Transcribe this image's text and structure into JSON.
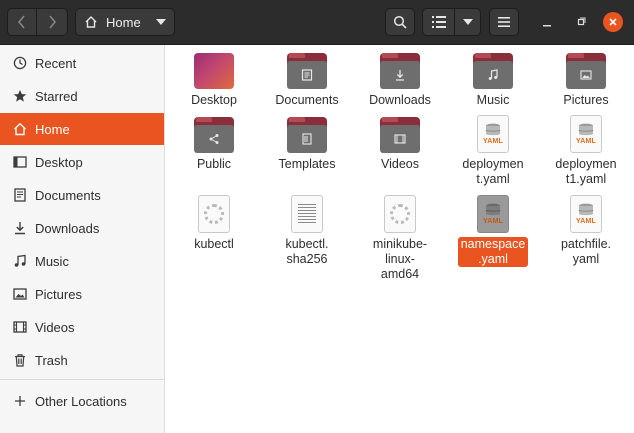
{
  "header": {
    "path_label": "Home",
    "accent_color": "#e95420"
  },
  "sidebar": {
    "items": [
      {
        "label": "Recent",
        "icon": "clock-icon"
      },
      {
        "label": "Starred",
        "icon": "star-icon"
      },
      {
        "label": "Home",
        "icon": "home-icon",
        "active": true
      },
      {
        "label": "Desktop",
        "icon": "desktop-icon"
      },
      {
        "label": "Documents",
        "icon": "document-icon"
      },
      {
        "label": "Downloads",
        "icon": "download-icon"
      },
      {
        "label": "Music",
        "icon": "music-icon"
      },
      {
        "label": "Pictures",
        "icon": "picture-icon"
      },
      {
        "label": "Videos",
        "icon": "video-icon"
      },
      {
        "label": "Trash",
        "icon": "trash-icon"
      },
      {
        "label": "Other Locations",
        "icon": "plus-icon"
      }
    ]
  },
  "files": [
    {
      "name": "Desktop",
      "type": "desktop-folder"
    },
    {
      "name": "Documents",
      "type": "folder",
      "icon": "document-icon"
    },
    {
      "name": "Downloads",
      "type": "folder",
      "icon": "download-icon"
    },
    {
      "name": "Music",
      "type": "folder",
      "icon": "music-icon"
    },
    {
      "name": "Pictures",
      "type": "folder",
      "icon": "picture-icon"
    },
    {
      "name": "Public",
      "type": "folder",
      "icon": "share-icon"
    },
    {
      "name": "Templates",
      "type": "folder",
      "icon": "template-icon"
    },
    {
      "name": "Videos",
      "type": "folder",
      "icon": "video-icon"
    },
    {
      "name": "deploymen\nt.yaml",
      "type": "yaml"
    },
    {
      "name": "deploymen\nt1.yaml",
      "type": "yaml"
    },
    {
      "name": "kubectl",
      "type": "executable"
    },
    {
      "name": "kubectl.\nsha256",
      "type": "text"
    },
    {
      "name": "minikube-\nlinux-\namd64",
      "type": "executable"
    },
    {
      "name": "namespace\n.yaml",
      "type": "yaml",
      "selected": true
    },
    {
      "name": "patchfile.\nyaml",
      "type": "yaml"
    }
  ],
  "yaml_tag": "YAML"
}
